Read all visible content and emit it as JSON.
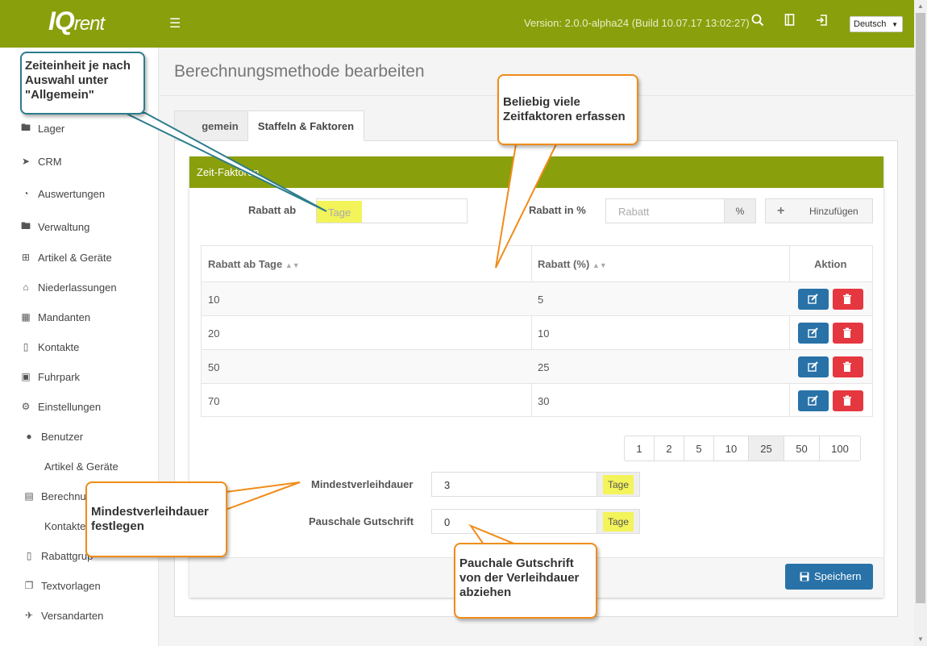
{
  "header": {
    "logo_main": "IQ",
    "logo_sub": "rent",
    "version": "Version: 2.0.0-alpha24 (Build 10.07.17 13:02:27)",
    "language": "Deutsch"
  },
  "sidebar": {
    "items": [
      {
        "label": "Lager",
        "icon": "folder-icon"
      },
      {
        "label": "CRM",
        "icon": "paper-plane-icon"
      },
      {
        "label": "Auswertungen",
        "icon": "pie-chart-icon"
      },
      {
        "label": "Verwaltung",
        "icon": "folder-icon"
      },
      {
        "label": "Artikel & Geräte",
        "icon": "grid-icon"
      },
      {
        "label": "Niederlassungen",
        "icon": "home-icon"
      },
      {
        "label": "Mandanten",
        "icon": "building-icon"
      },
      {
        "label": "Kontakte",
        "icon": "book-icon"
      },
      {
        "label": "Fuhrpark",
        "icon": "car-icon"
      },
      {
        "label": "Einstellungen",
        "icon": "cogs-icon"
      },
      {
        "label": "Benutzer",
        "icon": "user-icon"
      },
      {
        "label": "Artikel & Geräte"
      },
      {
        "label": "Berechnu",
        "icon": "list-icon"
      },
      {
        "label": "Kontakte"
      },
      {
        "label": "Rabattgrup",
        "icon": "book-icon"
      },
      {
        "label": "Textvorlagen",
        "icon": "files-icon"
      },
      {
        "label": "Versandarten",
        "icon": "plane-icon"
      }
    ]
  },
  "page": {
    "title": "Berechnungsmethode bearbeiten",
    "tabs": [
      "gemein",
      "Staffeln & Faktoren"
    ]
  },
  "card": {
    "title": "Zeit-Faktoren",
    "rabatt_ab_label": "Rabatt ab",
    "rabatt_ab_placeholder": "Tage",
    "rabatt_pct_label": "Rabatt in %",
    "rabatt_pct_placeholder": "Rabatt",
    "pct_addon": "%",
    "add_label": "Hinzufügen"
  },
  "table": {
    "headers": [
      "Rabatt ab Tage",
      "Rabatt (%)",
      "Aktion"
    ],
    "rows": [
      {
        "tage": "10",
        "rabatt": "5"
      },
      {
        "tage": "20",
        "rabatt": "10"
      },
      {
        "tage": "50",
        "rabatt": "25"
      },
      {
        "tage": "70",
        "rabatt": "30"
      }
    ]
  },
  "pagination": {
    "sizes": [
      "1",
      "2",
      "5",
      "10",
      "25",
      "50",
      "100"
    ],
    "active": "25"
  },
  "form": {
    "mindest_label": "Mindestverleihdauer",
    "mindest_value": "3",
    "mindest_unit": "Tage",
    "pauschal_label": "Pauschale Gutschrift",
    "pauschal_value": "0",
    "pauschal_unit": "Tage",
    "save_label": "Speichern"
  },
  "callouts": {
    "zeiteinheit": "Zeiteinheit je nach Auswahl unter \"Allgemein\"",
    "zeitfaktoren": "Beliebig viele Zeitfaktoren erfassen",
    "mindest": "Mindestverleihdauer festlegen",
    "pauschal": "Pauchale Gutschrift von der Verleihdauer abziehen"
  },
  "colors": {
    "brand": "#8a9f0c",
    "primary": "#2872a8",
    "danger": "#e5373f",
    "highlight": "#f3f35a",
    "callout_border": "#f08c1a",
    "callout_border_blue": "#2c7d8c"
  }
}
